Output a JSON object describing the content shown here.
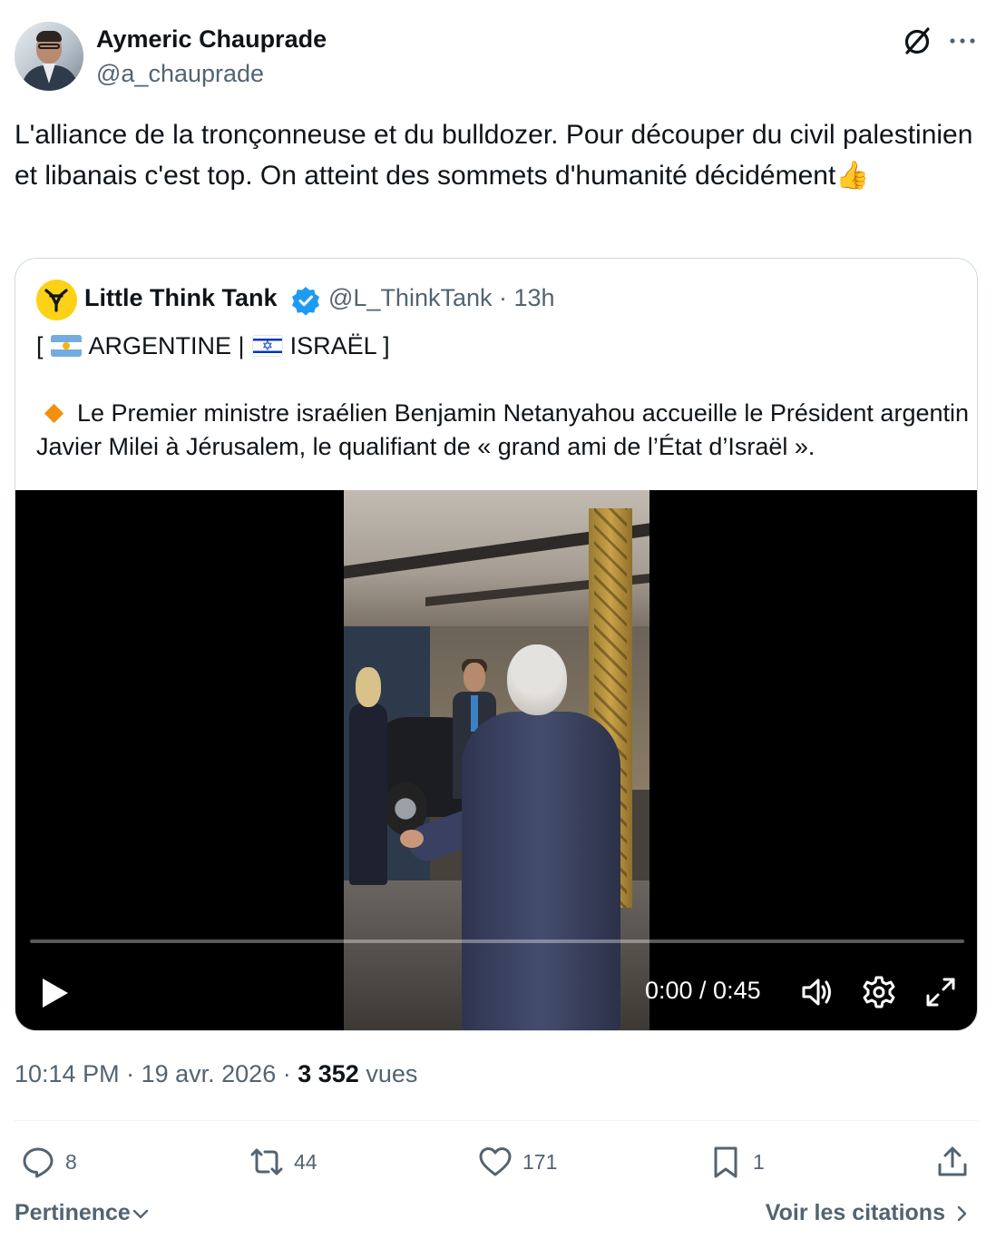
{
  "author": {
    "name": "Aymeric Chauprade",
    "handle": "@a_chauprade",
    "avatar_icon": "profile-photo"
  },
  "header_icons": {
    "grok": "grok-icon",
    "more": "more-options-icon"
  },
  "tweet": {
    "text": "L'alliance de la tronçonneuse et du bulldozer. Pour découper du civil palestinien et libanais c'est top. On atteint des sommets d'humanité décidément👍"
  },
  "quoted": {
    "name": "Little Think Tank",
    "verified": true,
    "handle": "@L_ThinkTank",
    "time": "13h",
    "handle_time": "@L_ThinkTank · 13h",
    "line1": {
      "open": "[",
      "country1": "ARGENTINE |",
      "country2": "ISRAËL ]"
    },
    "body": "Le Premier ministre israélien Benjamin Netanyahou accueille le Président argentin Javier Milei à Jérusalem, le qualifiant de « grand ami de l’État d’Israël ».",
    "video": {
      "time_display": "0:00 / 0:45",
      "current": "0:00",
      "duration": "0:45",
      "progress": 0
    }
  },
  "meta": {
    "time": "10:14 PM",
    "date": "19 avr. 2026",
    "views_count": "3 352",
    "views_label": "vues"
  },
  "actions": {
    "replies": "8",
    "reposts": "44",
    "likes": "171",
    "bookmarks": "1"
  },
  "footer": {
    "sort_label": "Pertinence",
    "quotes_label": "Voir les citations"
  },
  "colors": {
    "text": "#0f1419",
    "secondary": "#536471",
    "border": "#cfd9de",
    "verified": "#1d9bf0"
  }
}
